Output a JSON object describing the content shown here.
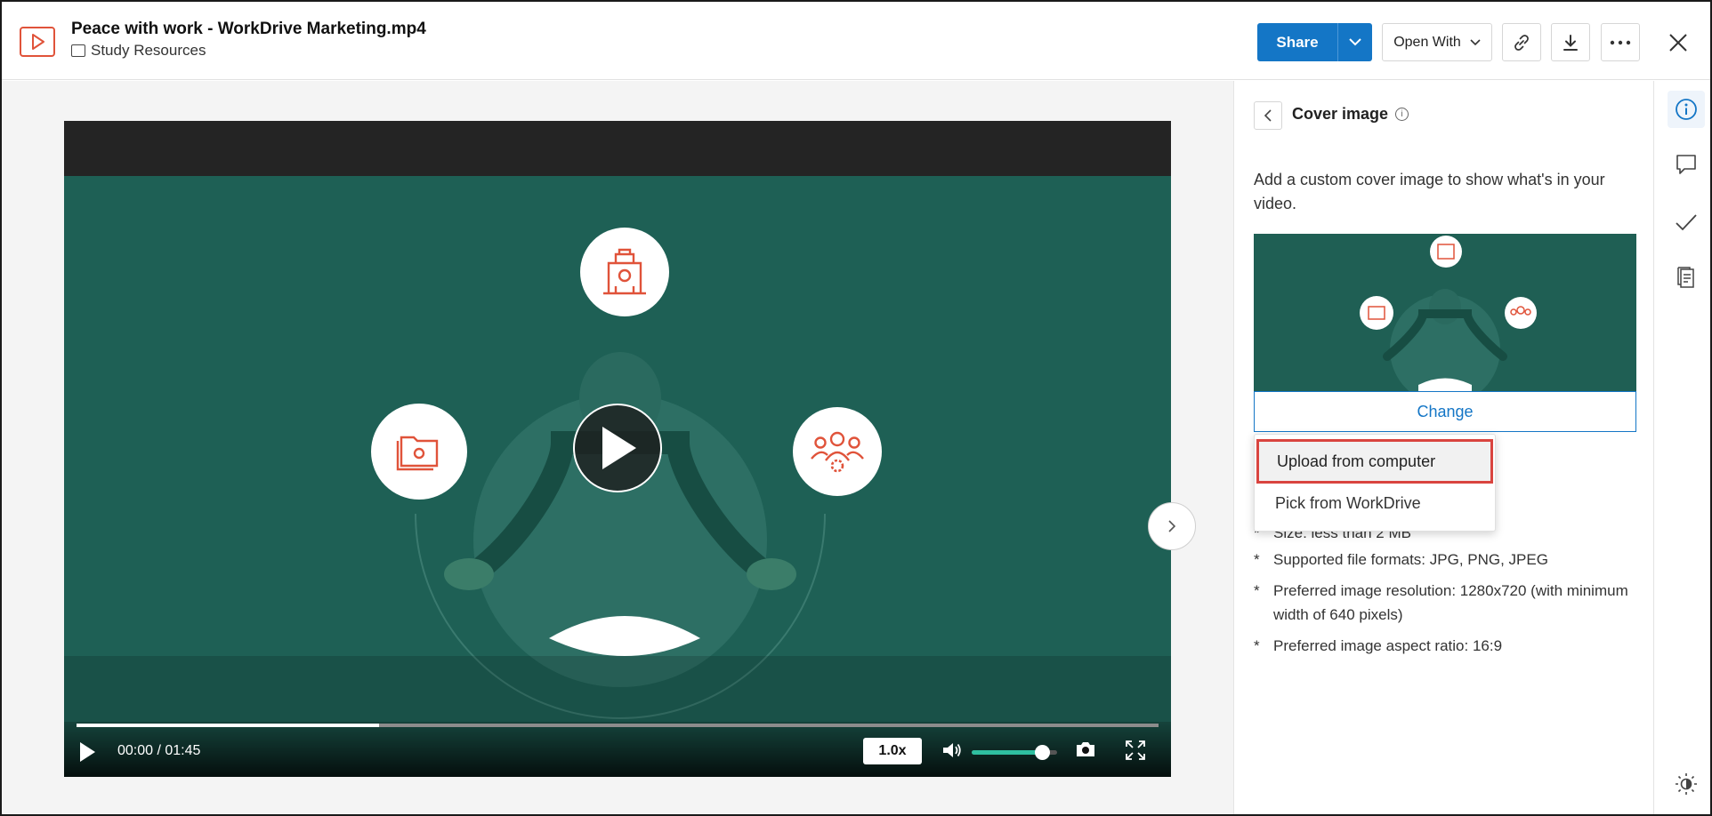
{
  "header": {
    "file_name": "Peace with work - WorkDrive Marketing.mp4",
    "folder_name": "Study Resources",
    "share_label": "Share",
    "open_with_label": "Open With"
  },
  "player": {
    "time_display": "00:00 / 01:45",
    "speed_label": "1.0x",
    "progress_fraction": 0.28,
    "volume_fraction": 0.82
  },
  "panel": {
    "title": "Cover image",
    "description": "Add a custom cover image to show what's in your video.",
    "change_label": "Change",
    "menu": [
      "Upload from computer",
      "Pick from WorkDrive"
    ],
    "rules": [
      "Size: less than 2 MB",
      "Supported file formats: JPG, PNG, JPEG",
      "Preferred image resolution: 1280x720 (with minimum width of 640 pixels)",
      "Preferred image aspect ratio: 16:9"
    ]
  },
  "colors": {
    "accent": "#1476c6",
    "video_bg": "#1e6055",
    "icon_orange": "#e0533a",
    "highlight_border": "#d9443f"
  }
}
